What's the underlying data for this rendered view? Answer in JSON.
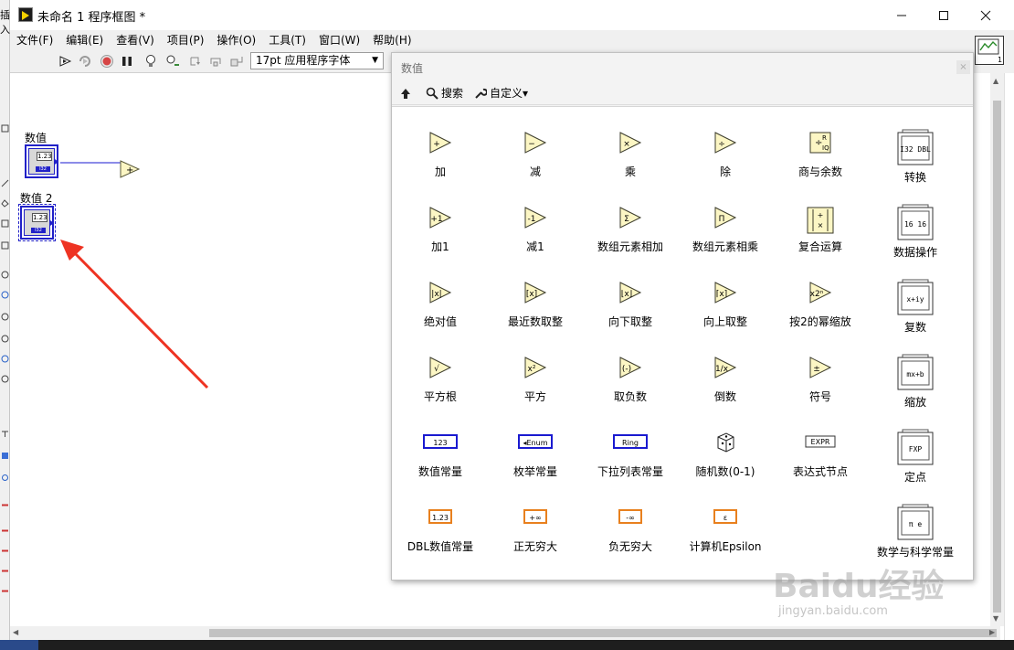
{
  "window": {
    "title": "未命名 1 程序框图 *",
    "left_strip_label": "插入"
  },
  "menubar": [
    {
      "label": "文件(F)"
    },
    {
      "label": "编辑(E)"
    },
    {
      "label": "查看(V)"
    },
    {
      "label": "项目(P)"
    },
    {
      "label": "操作(O)"
    },
    {
      "label": "工具(T)"
    },
    {
      "label": "窗口(W)"
    },
    {
      "label": "帮助(H)"
    }
  ],
  "toolbar": {
    "font_select": "17pt 应用程序字体",
    "icons": [
      "run-arrow-icon",
      "run-continuously-icon",
      "abort-icon",
      "pause-icon",
      "highlight-execution-icon",
      "retain-wire-values-icon",
      "step-into-icon",
      "step-over-icon",
      "step-out-icon"
    ]
  },
  "vi_icon_number": "1",
  "diagram": {
    "nodes": [
      {
        "label": "数值",
        "value_text": "1.23",
        "type_text": "I32"
      },
      {
        "label": "数值 2",
        "value_text": "1.23",
        "type_text": "I32"
      }
    ],
    "add_function_glyph": "+",
    "arrow_color": "#ee3322"
  },
  "palette": {
    "title": "数值",
    "tools": {
      "search": "搜索",
      "customize": "自定义▾"
    },
    "items": [
      {
        "label": "加",
        "glyph": "+",
        "kind": "tri"
      },
      {
        "label": "减",
        "glyph": "−",
        "kind": "tri"
      },
      {
        "label": "乘",
        "glyph": "×",
        "kind": "tri"
      },
      {
        "label": "除",
        "glyph": "÷",
        "kind": "tri"
      },
      {
        "label": "商与余数",
        "glyph": "R IQ",
        "kind": "qr"
      },
      {
        "label": "转换",
        "glyph": "I32 DBL",
        "kind": "folder"
      },
      {
        "label": "加1",
        "glyph": "+1",
        "kind": "tri"
      },
      {
        "label": "减1",
        "glyph": "-1",
        "kind": "tri"
      },
      {
        "label": "数组元素相加",
        "glyph": "Σ",
        "kind": "tri"
      },
      {
        "label": "数组元素相乘",
        "glyph": "Π",
        "kind": "tri"
      },
      {
        "label": "复合运算",
        "glyph": "+×",
        "kind": "compound"
      },
      {
        "label": "数据操作",
        "glyph": "16 16",
        "kind": "folder"
      },
      {
        "label": "绝对值",
        "glyph": "|x|",
        "kind": "tri"
      },
      {
        "label": "最近数取整",
        "glyph": "[x]",
        "kind": "tri"
      },
      {
        "label": "向下取整",
        "glyph": "⌊x⌋",
        "kind": "tri"
      },
      {
        "label": "向上取整",
        "glyph": "⌈x⌉",
        "kind": "tri"
      },
      {
        "label": "按2的幂缩放",
        "glyph": "x2ⁿ",
        "kind": "tri"
      },
      {
        "label": "复数",
        "glyph": "x+iy",
        "kind": "folder"
      },
      {
        "label": "平方根",
        "glyph": "√",
        "kind": "tri"
      },
      {
        "label": "平方",
        "glyph": "x²",
        "kind": "tri"
      },
      {
        "label": "取负数",
        "glyph": "(-)",
        "kind": "tri"
      },
      {
        "label": "倒数",
        "glyph": "1/x",
        "kind": "tri"
      },
      {
        "label": "符号",
        "glyph": "±",
        "kind": "tri"
      },
      {
        "label": "缩放",
        "glyph": "mx+b",
        "kind": "folder"
      },
      {
        "label": "数值常量",
        "glyph": "123",
        "kind": "const-blue"
      },
      {
        "label": "枚举常量",
        "glyph": "◂Enum",
        "kind": "const-blue"
      },
      {
        "label": "下拉列表常量",
        "glyph": "Ring",
        "kind": "const-blue"
      },
      {
        "label": "随机数(0-1)",
        "glyph": "dice",
        "kind": "dice"
      },
      {
        "label": "表达式节点",
        "glyph": "EXPR",
        "kind": "expr"
      },
      {
        "label": "定点",
        "glyph": "FXP",
        "kind": "folder"
      },
      {
        "label": "DBL数值常量",
        "glyph": "1.23",
        "kind": "const-orange"
      },
      {
        "label": "正无穷大",
        "glyph": "+∞",
        "kind": "const-orange"
      },
      {
        "label": "负无穷大",
        "glyph": "-∞",
        "kind": "const-orange"
      },
      {
        "label": "计算机Epsilon",
        "glyph": "ε",
        "kind": "const-orange"
      },
      {
        "label": "",
        "glyph": "",
        "kind": "none"
      },
      {
        "label": "数学与科学常量",
        "glyph": "π e",
        "kind": "folder2"
      }
    ]
  },
  "watermark": {
    "text": "Baidu经验",
    "sub": "jingyan.baidu.com"
  }
}
